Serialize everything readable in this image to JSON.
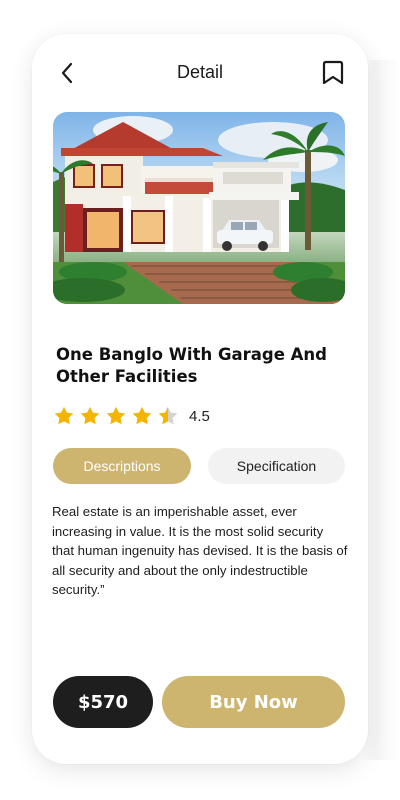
{
  "header": {
    "title": "Detail",
    "back_icon": "chevron-left-icon",
    "bookmark_icon": "bookmark-icon"
  },
  "product": {
    "title": "One Banglo With Garage And Other Facilities",
    "rating": {
      "value": "4.5",
      "stars": 4.5,
      "max": 5
    },
    "image": "house-photo"
  },
  "tabs": [
    {
      "label": "Descriptions",
      "active": true
    },
    {
      "label": "Specification",
      "active": false
    }
  ],
  "description": "Real estate is an imperishable asset, ever increasing in value. It is the most solid security that human ingenuity has devised. It is the basis of all security and about the only indestructible security.”",
  "actions": {
    "price": "$570",
    "buy_label": "Buy Now"
  },
  "colors": {
    "accent": "#cdb56f",
    "dark": "#1e1e1e",
    "star": "#f4b400",
    "tab_inactive_bg": "#f2f2f2"
  }
}
